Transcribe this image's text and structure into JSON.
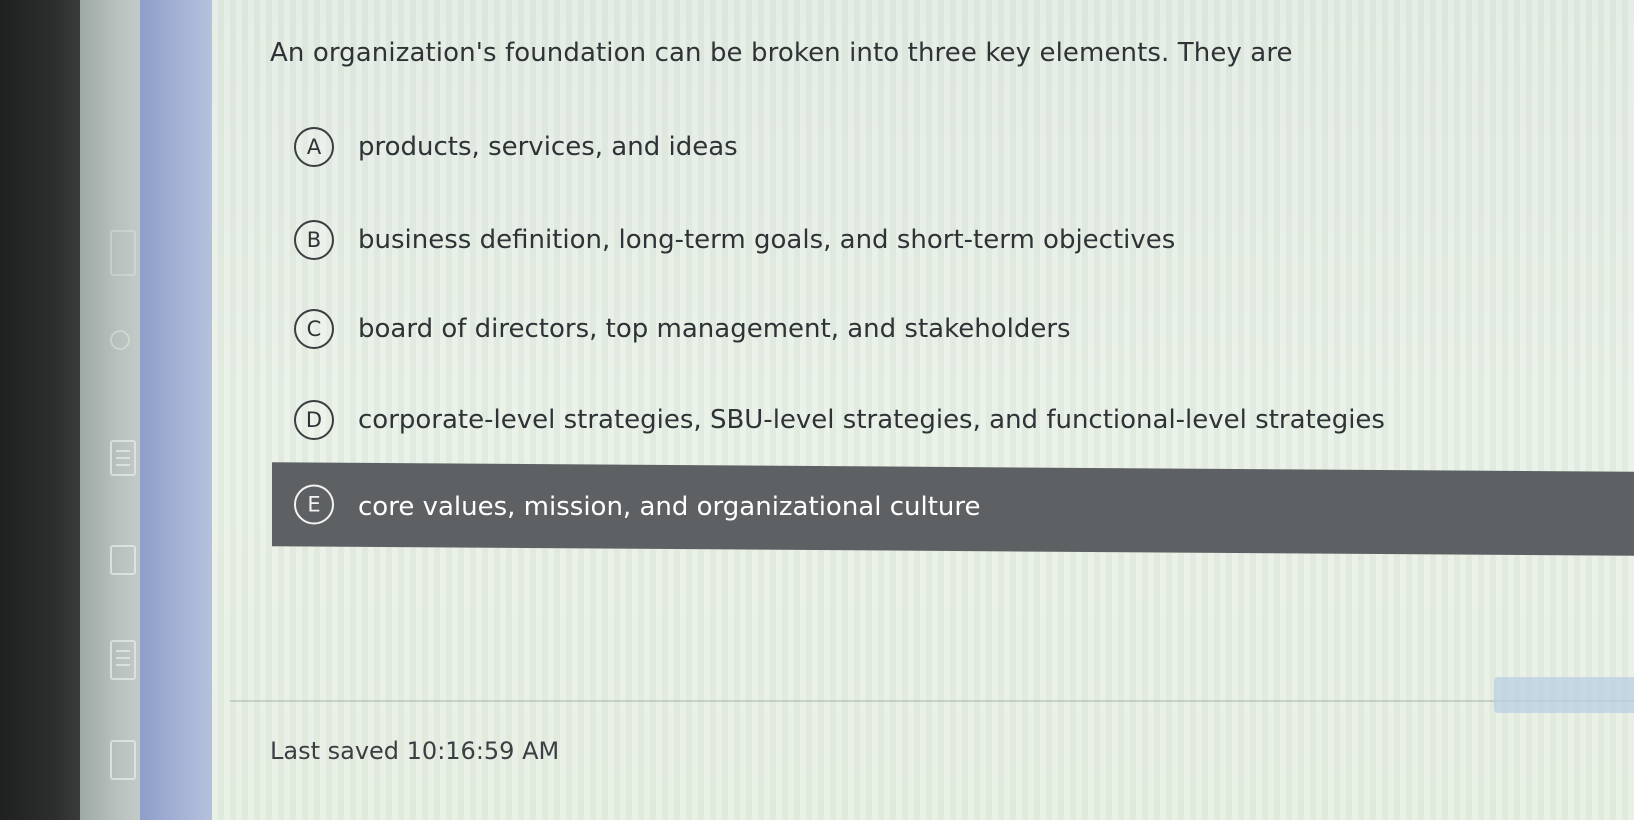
{
  "question": {
    "text": "An organization's foundation can be broken into three key elements. They are"
  },
  "options": [
    {
      "letter": "A",
      "text": "products, services, and ideas",
      "selected": false
    },
    {
      "letter": "B",
      "text": "business definition, long-term goals, and short-term objectives",
      "selected": false
    },
    {
      "letter": "C",
      "text": "board of directors, top management, and stakeholders",
      "selected": false
    },
    {
      "letter": "D",
      "text": "corporate-level strategies, SBU-level strategies, and functional-level strategies",
      "selected": false
    },
    {
      "letter": "E",
      "text": "core values, mission, and organizational culture",
      "selected": true
    }
  ],
  "footer": {
    "last_saved": "Last saved 10:16:59 AM"
  },
  "colors": {
    "selected_bg": "#5e6163",
    "background": "#e3ecdf",
    "text": "#2f3336"
  }
}
